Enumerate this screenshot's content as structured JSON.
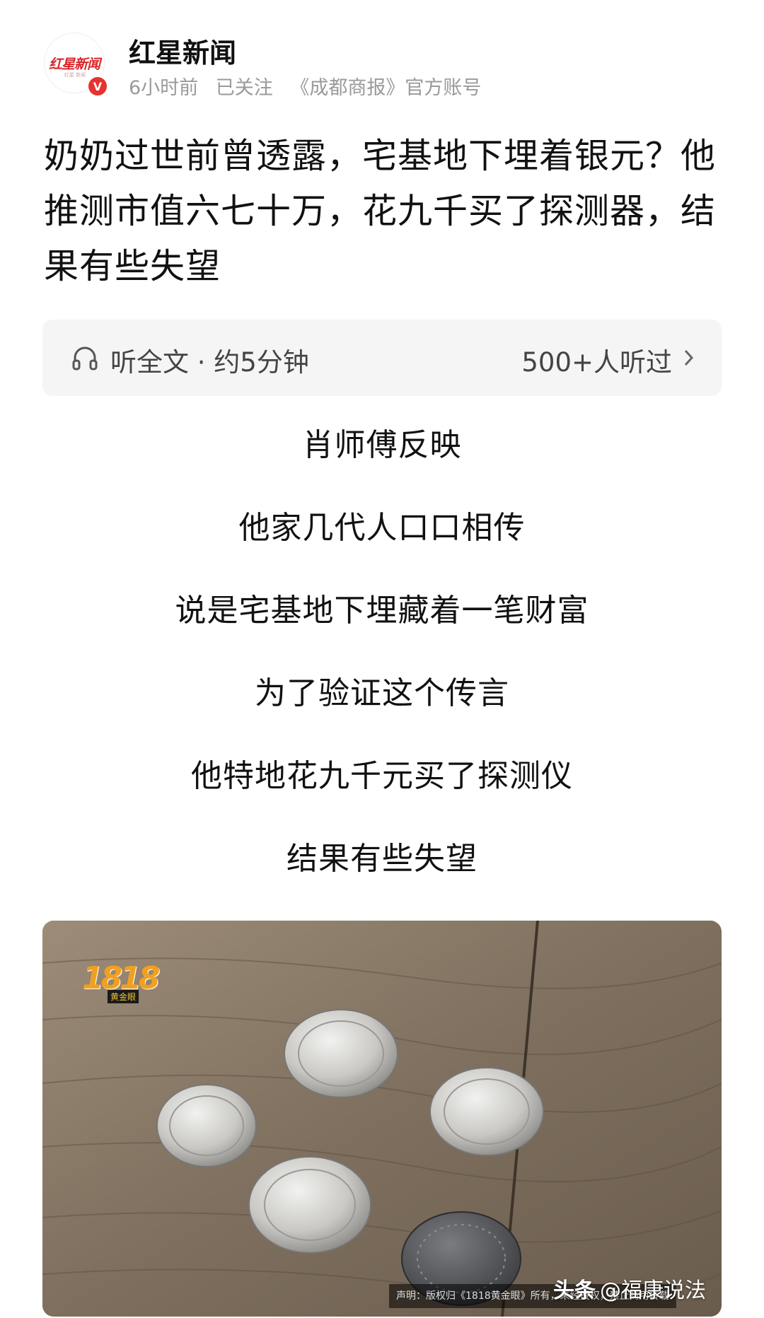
{
  "header": {
    "logo_text": "红星新闻",
    "logo_sub": "红星 新闻",
    "verified_badge": "V",
    "account_name": "红星新闻",
    "time_ago": "6小时前",
    "follow_status": "已关注",
    "account_desc": "《成都商报》官方账号"
  },
  "article": {
    "title": "奶奶过世前曾透露，宅基地下埋着银元？他推测市值六七十万，花九千买了探测器，结果有些失望"
  },
  "listen": {
    "label": "听全文 · 约5分钟",
    "count": "500+人听过"
  },
  "body_lines": [
    "肖师傅反映",
    "他家几代人口口相传",
    "说是宅基地下埋藏着一笔财富",
    "为了验证这个传言",
    "他特地花九千元买了探测仪",
    "结果有些失望"
  ],
  "image": {
    "logo_number": "1818",
    "logo_sub": "黄金眼",
    "disclaimer": "声明：版权归《1818黄金眼》所有，未经授权，禁止商用转载",
    "watermark_prefix": "头条",
    "watermark_author": "@福康说法"
  },
  "colors": {
    "accent_red": "#e8322d",
    "meta_gray": "#9a9a9a",
    "listen_bg": "#f5f5f5"
  },
  "icons": {
    "headphone": "headphone-icon",
    "chevron": "chevron-right-icon",
    "verified": "verified-icon"
  }
}
